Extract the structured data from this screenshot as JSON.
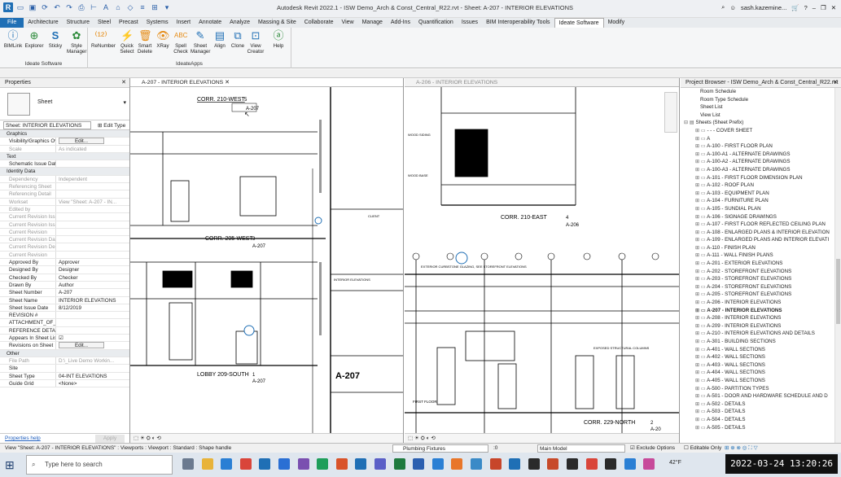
{
  "titlebar": {
    "title": "Autodesk Revit 2022.1 - ISW Demo_Arch & Const_Central_R22.rvt - Sheet: A-207 - INTERIOR ELEVATIONS",
    "user": "sash.kazemine..."
  },
  "tabs": [
    "File",
    "Architecture",
    "Structure",
    "Steel",
    "Precast",
    "Systems",
    "Insert",
    "Annotate",
    "Analyze",
    "Massing & Site",
    "Collaborate",
    "View",
    "Manage",
    "Add-Ins",
    "Quantification",
    "Issues",
    "BIM Interoperability Tools",
    "Ideate Software",
    "Modify"
  ],
  "active_tab": "Ideate Software",
  "ribbon": {
    "group1": {
      "label": "Ideate Software",
      "buttons": [
        "BIMLink",
        "Explorer",
        "Sticky",
        "Style Manager"
      ]
    },
    "group2": {
      "label": "IdeateApps",
      "buttons": [
        "ReNumber",
        "Quick Select",
        "Smart Delete",
        "XRay",
        "Spell Check",
        "Sheet Manager",
        "Align",
        "Clone",
        "View Creator",
        "Help"
      ]
    }
  },
  "properties": {
    "title": "Properties",
    "type_name": "Sheet",
    "selector": "Sheet: INTERIOR ELEVATIONS",
    "edit_type": "Edit Type",
    "rows": [
      {
        "cat": "Graphics"
      },
      {
        "k": "Visibility/Graphics Ove...",
        "v": "Edit...",
        "btn": true
      },
      {
        "k": "Scale",
        "v": "As indicated",
        "grey": true
      },
      {
        "cat": "Text"
      },
      {
        "k": "Schematic Issue Date",
        "v": ""
      },
      {
        "cat": "Identity Data"
      },
      {
        "k": "Dependency",
        "v": "Independent",
        "grey": true
      },
      {
        "k": "Referencing Sheet",
        "v": "",
        "grey": true
      },
      {
        "k": "Referencing Detail",
        "v": "",
        "grey": true
      },
      {
        "k": "Workset",
        "v": "View \"Sheet: A-207 - IN...",
        "grey": true
      },
      {
        "k": "Edited by",
        "v": "",
        "grey": true
      },
      {
        "k": "Current Revision Issued",
        "v": "",
        "grey": true
      },
      {
        "k": "Current Revision Issue...",
        "v": "",
        "grey": true
      },
      {
        "k": "Current Revision",
        "v": "",
        "grey": true
      },
      {
        "k": "Current Revision Date",
        "v": "",
        "grey": true
      },
      {
        "k": "Current Revision Descr...",
        "v": "",
        "grey": true
      },
      {
        "k": "Current Revision",
        "v": "",
        "grey": true
      },
      {
        "k": "Approved By",
        "v": "Approver"
      },
      {
        "k": "Designed By",
        "v": "Designer"
      },
      {
        "k": "Checked By",
        "v": "Checker"
      },
      {
        "k": "Drawn By",
        "v": "Author"
      },
      {
        "k": "Sheet Number",
        "v": "A-207"
      },
      {
        "k": "Sheet Name",
        "v": "INTERIOR ELEVATIONS"
      },
      {
        "k": "Sheet Issue Date",
        "v": "8/12/2019"
      },
      {
        "k": "REVISION #",
        "v": ""
      },
      {
        "k": "ATTACHMENT_OF_",
        "v": ""
      },
      {
        "k": "REFERENCE DETAIL",
        "v": ""
      },
      {
        "k": "Appears In Sheet List",
        "v": "☑"
      },
      {
        "k": "Revisions on Sheet",
        "v": "Edit...",
        "btn": true
      },
      {
        "cat": "Other"
      },
      {
        "k": "File Path",
        "v": "D:\\_Live Demo Workin...",
        "grey": true
      },
      {
        "k": "Site",
        "v": ""
      },
      {
        "k": "Sheet Type",
        "v": "04-INT ELEVATIONS"
      },
      {
        "k": "Guide Grid",
        "v": "<None>"
      }
    ],
    "help": "Properties help",
    "apply": "Apply"
  },
  "view1": {
    "tab": "A-207 - INTERIOR ELEVATIONS",
    "labels": {
      "corr_west_top": "CORR. 210-WEST",
      "corr_west_num": "5",
      "corr_west_sheet": "A-207",
      "corr205": "CORR. 205-WEST",
      "corr205_num": "3",
      "corr205_sheet": "A-207",
      "lobby": "LOBBY 209-SOUTH",
      "lobby_num": "1",
      "lobby_sheet": "A-207",
      "sheetnum": "A-207",
      "client": "CLIENT",
      "int_elev": "INTERIOR ELEVATIONS",
      "scale": "1/4\" = 1'-0\""
    }
  },
  "view2": {
    "tab": "A-206 - INTERIOR ELEVATIONS",
    "labels": {
      "corr_east": "CORR. 210-EAST",
      "corr_east_num": "4",
      "corr_east_sheet": "A-206",
      "corr229": "CORR. 229-NORTH",
      "corr229_num": "2",
      "corr229_sheet": "A-20",
      "first_floor": "FIRST FLOOR",
      "wood_siding": "WOOD SIDING",
      "wood_base": "WOOD BASE",
      "exposed": "EXPOSED STRUCTURAL COLUMNS",
      "exterior": "EXTERIOR CURBSTONE GLAZING, SEE STOREFRONT ELEVATIONS"
    }
  },
  "browser": {
    "title": "Project Browser - ISW Demo_Arch & Const_Central_R22.rvt",
    "items": [
      "Room Schedule",
      "Room Type Schedule",
      "Sheet List",
      "View List",
      "Sheets (Sheet Prefix)",
      "- - - COVER SHEET",
      "A",
      "A-100 - FIRST FLOOR PLAN",
      "A-100-A1 - ALTERNATE DRAWINGS",
      "A-100-A2 - ALTERNATE DRAWINGS",
      "A-100-A3 - ALTERNATE DRAWINGS",
      "A-101 - FIRST FLOOR DIMENSION PLAN",
      "A-102 - ROOF PLAN",
      "A-103 - EQUIPMENT PLAN",
      "A-104 - FURNITURE PLAN",
      "A-105 - SUNDIAL PLAN",
      "A-106 - SIGNAGE DRAWINGS",
      "A-107 - FIRST FLOOR REFLECTED CEILING PLAN",
      "A-108 - ENLARGED PLANS & INTERIOR ELEVATION",
      "A-109 - ENLARGED PLANS AND INTERIOR ELEVATI",
      "A-110 - FINISH PLAN",
      "A-111 - WALL FINISH PLANS",
      "A-201 - EXTERIOR ELEVATIONS",
      "A-202 - STOREFRONT ELEVATIONS",
      "A-203 - STOREFRONT ELEVATIONS",
      "A-204 - STOREFRONT ELEVATIONS",
      "A-205 - STOREFRONT ELEVATIONS",
      "A-206 - INTERIOR ELEVATIONS",
      "A-207 - INTERIOR ELEVATIONS",
      "A-208 - INTERIOR ELEVATIONS",
      "A-209 - INTERIOR ELEVATIONS",
      "A-210 - INTERIOR ELEVATIONS AND DETAILS",
      "A-301 - BUILDING SECTIONS",
      "A-401 - WALL SECTIONS",
      "A-402 - WALL SECTIONS",
      "A-403 - WALL SECTIONS",
      "A-404 - WALL SECTIONS",
      "A-405 - WALL SECTIONS",
      "A-500 - PARTITION TYPES",
      "A-501 - DOOR AND HARDWARE SCHEDULE AND D",
      "A-502 - DETAILS",
      "A-503 - DETAILS",
      "A-504 - DETAILS",
      "A-505 - DETAILS"
    ],
    "bold_index": 28
  },
  "status": {
    "text": "View \"Sheet: A-207 - INTERIOR ELEVATIONS\" : Viewports : Viewport : Standard : Shape handle",
    "category": "Plumbing Fixtures",
    "model": "Main Model",
    "exclude": "Exclude Options",
    "editable": "Editable Only",
    "zero": ":0"
  },
  "taskbar": {
    "search": "Type here to search",
    "clock": "2022-03-24 13:20:26",
    "temp": "42°F"
  }
}
